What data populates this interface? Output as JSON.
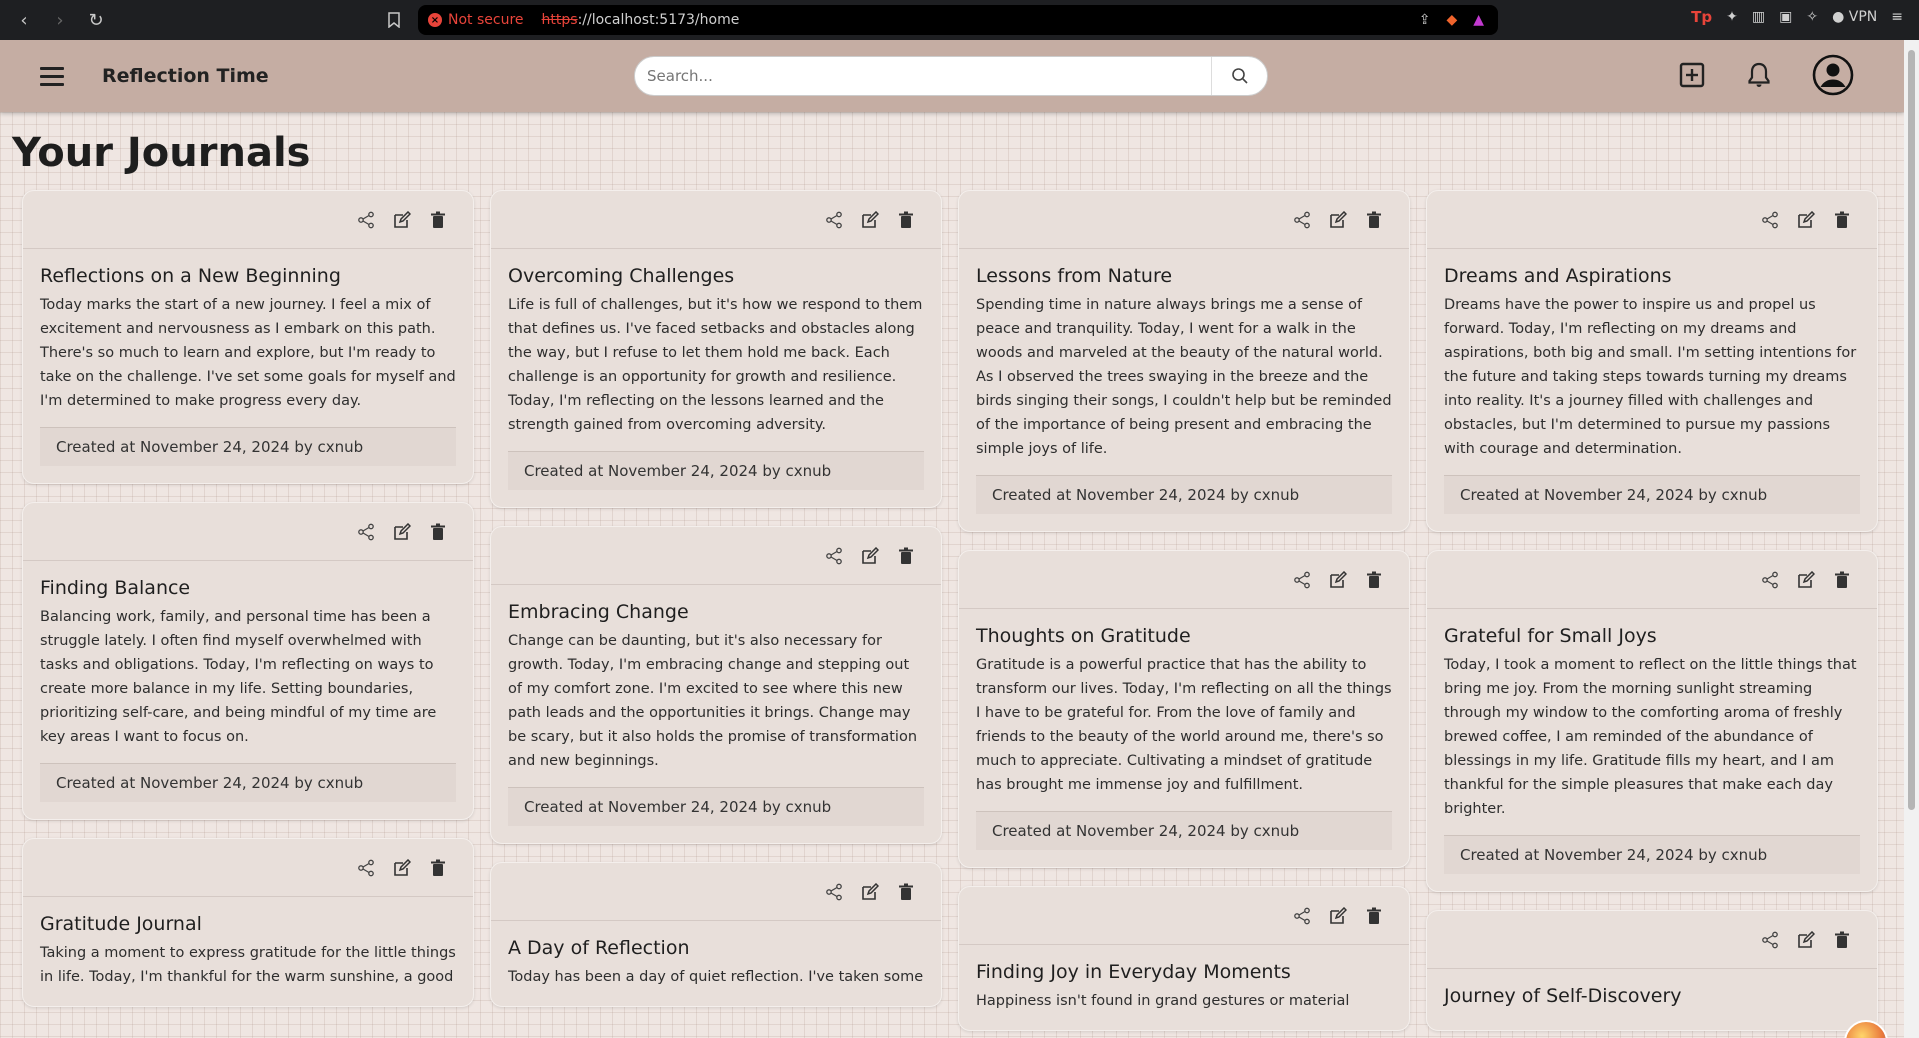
{
  "browser": {
    "not_secure": "Not secure",
    "url_scheme": "https",
    "url_rest": "://localhost:5173/home",
    "vpn": "VPN",
    "tp": "Tp"
  },
  "header": {
    "title": "Reflection Time",
    "search_placeholder": "Search..."
  },
  "page": {
    "title": "Your Journals"
  },
  "columns": [
    [
      {
        "title": "Reflections on a New Beginning",
        "text": "Today marks the start of a new journey. I feel a mix of excitement and nervousness as I embark on this path. There's so much to learn and explore, but I'm ready to take on the challenge. I've set some goals for myself and I'm determined to make progress every day.",
        "footer": "Created at November 24, 2024 by cxnub"
      },
      {
        "title": "Finding Balance",
        "text": "Balancing work, family, and personal time has been a struggle lately. I often find myself overwhelmed with tasks and obligations. Today, I'm reflecting on ways to create more balance in my life. Setting boundaries, prioritizing self-care, and being mindful of my time are key areas I want to focus on.",
        "footer": "Created at November 24, 2024 by cxnub"
      },
      {
        "title": "Gratitude Journal",
        "text": "Taking a moment to express gratitude for the little things in life. Today, I'm thankful for the warm sunshine, a good",
        "footer": ""
      }
    ],
    [
      {
        "title": "Overcoming Challenges",
        "text": "Life is full of challenges, but it's how we respond to them that defines us. I've faced setbacks and obstacles along the way, but I refuse to let them hold me back. Each challenge is an opportunity for growth and resilience. Today, I'm reflecting on the lessons learned and the strength gained from overcoming adversity.",
        "footer": "Created at November 24, 2024 by cxnub"
      },
      {
        "title": "Embracing Change",
        "text": "Change can be daunting, but it's also necessary for growth. Today, I'm embracing change and stepping out of my comfort zone. I'm excited to see where this new path leads and the opportunities it brings. Change may be scary, but it also holds the promise of transformation and new beginnings.",
        "footer": "Created at November 24, 2024 by cxnub"
      },
      {
        "title": "A Day of Reflection",
        "text": "Today has been a day of quiet reflection. I've taken some",
        "footer": ""
      }
    ],
    [
      {
        "title": "Lessons from Nature",
        "text": "Spending time in nature always brings me a sense of peace and tranquility. Today, I went for a walk in the woods and marveled at the beauty of the natural world. As I observed the trees swaying in the breeze and the birds singing their songs, I couldn't help but be reminded of the importance of being present and embracing the simple joys of life.",
        "footer": "Created at November 24, 2024 by cxnub"
      },
      {
        "title": "Thoughts on Gratitude",
        "text": "Gratitude is a powerful practice that has the ability to transform our lives. Today, I'm reflecting on all the things I have to be grateful for. From the love of family and friends to the beauty of the world around me, there's so much to appreciate. Cultivating a mindset of gratitude has brought me immense joy and fulfillment.",
        "footer": "Created at November 24, 2024 by cxnub"
      },
      {
        "title": "Finding Joy in Everyday Moments",
        "text": "Happiness isn't found in grand gestures or material",
        "footer": ""
      }
    ],
    [
      {
        "title": "Dreams and Aspirations",
        "text": "Dreams have the power to inspire us and propel us forward. Today, I'm reflecting on my dreams and aspirations, both big and small. I'm setting intentions for the future and taking steps towards turning my dreams into reality. It's a journey filled with challenges and obstacles, but I'm determined to pursue my passions with courage and determination.",
        "footer": "Created at November 24, 2024 by cxnub"
      },
      {
        "title": "Grateful for Small Joys",
        "text": "Today, I took a moment to reflect on the little things that bring me joy. From the morning sunlight streaming through my window to the comforting aroma of freshly brewed coffee, I am reminded of the abundance of blessings in my life. Gratitude fills my heart, and I am thankful for the simple pleasures that make each day brighter.",
        "footer": "Created at November 24, 2024 by cxnub"
      },
      {
        "title": "Journey of Self-Discovery",
        "text": "",
        "footer": ""
      }
    ]
  ]
}
